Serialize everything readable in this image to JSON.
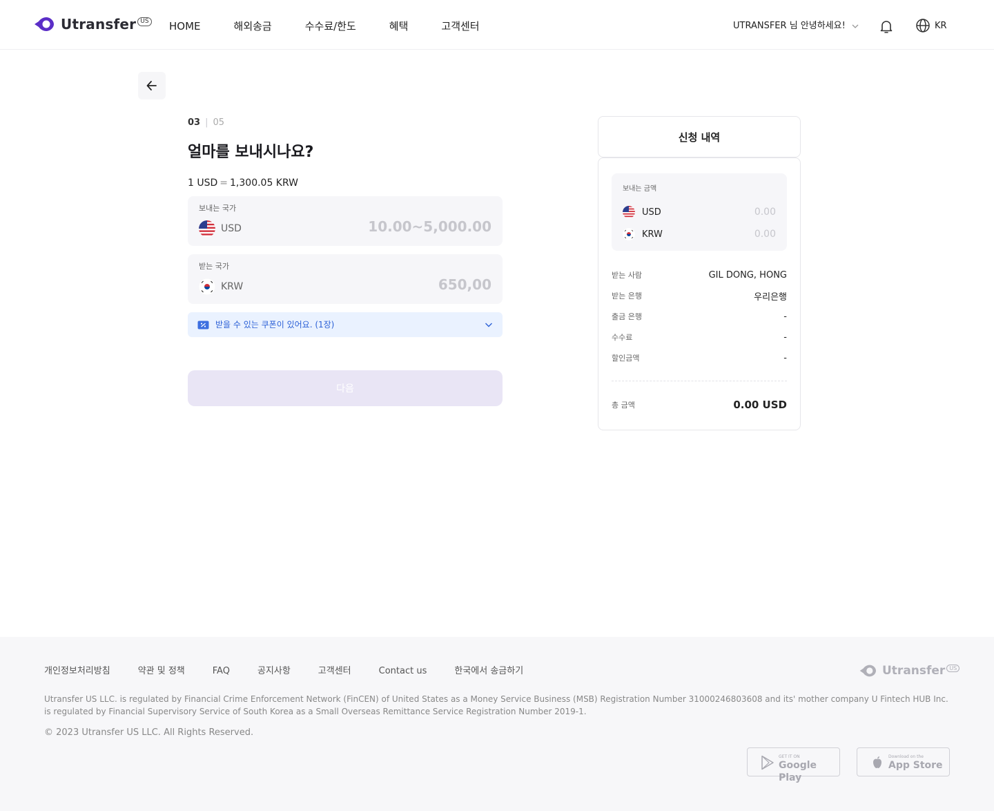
{
  "header": {
    "logo_text": "Utransfer",
    "logo_badge": "US",
    "nav": [
      "HOME",
      "해외송금",
      "수수료/한도",
      "혜택",
      "고객센터"
    ],
    "user_greeting": "UTRANSFER 님 안녕하세요!",
    "lang": "KR",
    "icons": {
      "bell": "bell-icon",
      "globe": "globe-icon",
      "chevron": "chevron-down-icon"
    }
  },
  "form": {
    "step_current": "03",
    "step_sep": "|",
    "step_total": "05",
    "title": "얼마를 보내시나요?",
    "rate_left": "1 USD",
    "rate_eq": "=",
    "rate_right": "1,300.05 KRW",
    "send": {
      "label": "보내는 국가",
      "currency": "USD",
      "placeholder": "10.00~5,000.00"
    },
    "receive": {
      "label": "받는 국가",
      "currency": "KRW",
      "placeholder": "650,00"
    },
    "coupon_text": "받을 수 있는 쿠폰이 있어요. (1장)",
    "next_label": "다음"
  },
  "summary": {
    "title": "신청 내역",
    "amount_label": "보내는 금액",
    "usd": {
      "currency": "USD",
      "value": "0.00"
    },
    "krw": {
      "currency": "KRW",
      "value": "0.00"
    },
    "rows": [
      {
        "key": "받는 사람",
        "value": "GIL DONG, HONG"
      },
      {
        "key": "받는 은행",
        "value": "우리은행"
      },
      {
        "key": "출금 은행",
        "value": "-"
      },
      {
        "key": "수수료",
        "value": "-"
      },
      {
        "key": "할인금액",
        "value": "-"
      }
    ],
    "total_label": "총 금액",
    "total_value": "0.00 USD"
  },
  "footer": {
    "links": [
      "개인정보처리방침",
      "약관 및 정책",
      "FAQ",
      "공지사항",
      "고객센터",
      "Contact us",
      "한국에서 송금하기"
    ],
    "logo_text": "Utransfer",
    "logo_badge": "US",
    "legal": "Utransfer US LLC. is regulated by Financial Crime Enforcement Network (FinCEN) of United States as a Money Service Business (MSB) Registration Number 31000246803608 and its' mother company U Fintech HUB Inc. is regulated by Financial Supervisory Service of South Korea as a Small Overseas Remittance Service Registration Number 2019-1.",
    "copyright": "© 2023 Utransfer US LLC. All Rights Reserved.",
    "google_small": "GET IT ON",
    "google_large": "Google Play",
    "apple_small": "Download on the",
    "apple_large": "App Store"
  },
  "colors": {
    "brand": "#5b2ec7",
    "coupon_text": "#2a5fd6",
    "next_disabled": "#e9e5f5"
  }
}
